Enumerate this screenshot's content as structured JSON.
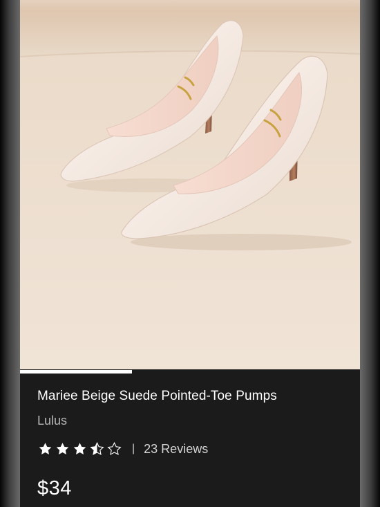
{
  "product": {
    "title": "Mariee Beige Suede Pointed-Toe Pumps",
    "brand": "Lulus",
    "rating": 3.5,
    "rating_max": 5,
    "divider": "|",
    "reviews_text": "23 Reviews",
    "price": "$34"
  },
  "carousel": {
    "progress_fraction": 0.33
  },
  "colors": {
    "background": "#1b1b1b",
    "text": "#ffffff",
    "muted_text": "#b7b7b7",
    "image_backdrop": "#e9d9c7"
  },
  "icons": {
    "star_full": "star-icon",
    "star_half": "half-star-icon",
    "star_empty": "empty-star-icon"
  }
}
